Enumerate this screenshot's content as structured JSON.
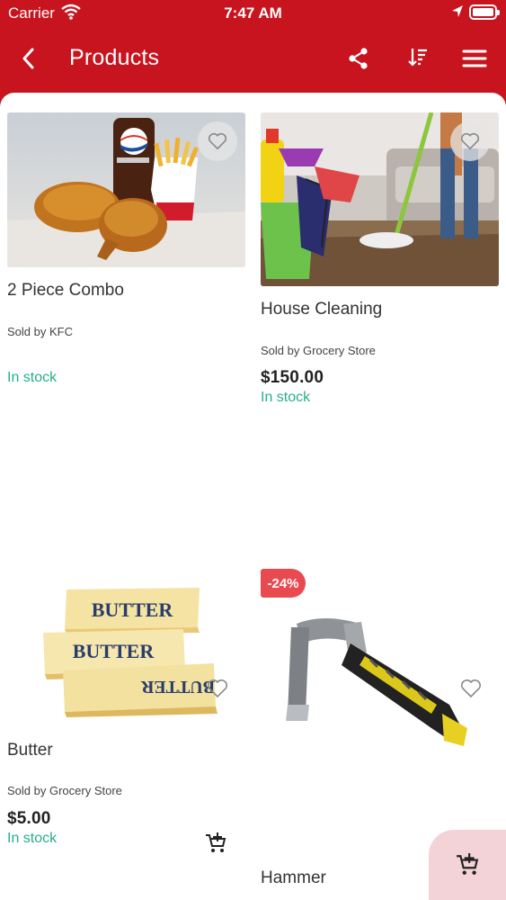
{
  "status": {
    "carrier": "Carrier",
    "time": "7:47 AM"
  },
  "header": {
    "title": "Products"
  },
  "products": [
    {
      "name": "2 Piece Combo",
      "seller": "Sold by KFC",
      "price": "",
      "stock": "In stock"
    },
    {
      "name": "House Cleaning",
      "seller": "Sold by Grocery Store",
      "price": "$150.00",
      "stock": "In stock"
    },
    {
      "name": "Butter",
      "seller": "Sold by Grocery Store",
      "price": "$5.00",
      "stock": "In stock"
    },
    {
      "name": "Hammer",
      "seller": "",
      "price": "",
      "stock": "",
      "discount": "-24%"
    }
  ],
  "icons": {
    "back": "chevron-left-icon",
    "share": "share-icon",
    "sort": "sort-icon",
    "menu": "hamburger-menu-icon",
    "favorite": "heart-icon",
    "cart": "add-to-cart-icon"
  },
  "colors": {
    "primary": "#c8141e",
    "stock": "#23b08a",
    "discount": "#e84a50",
    "fab": "#f4d3d8"
  }
}
